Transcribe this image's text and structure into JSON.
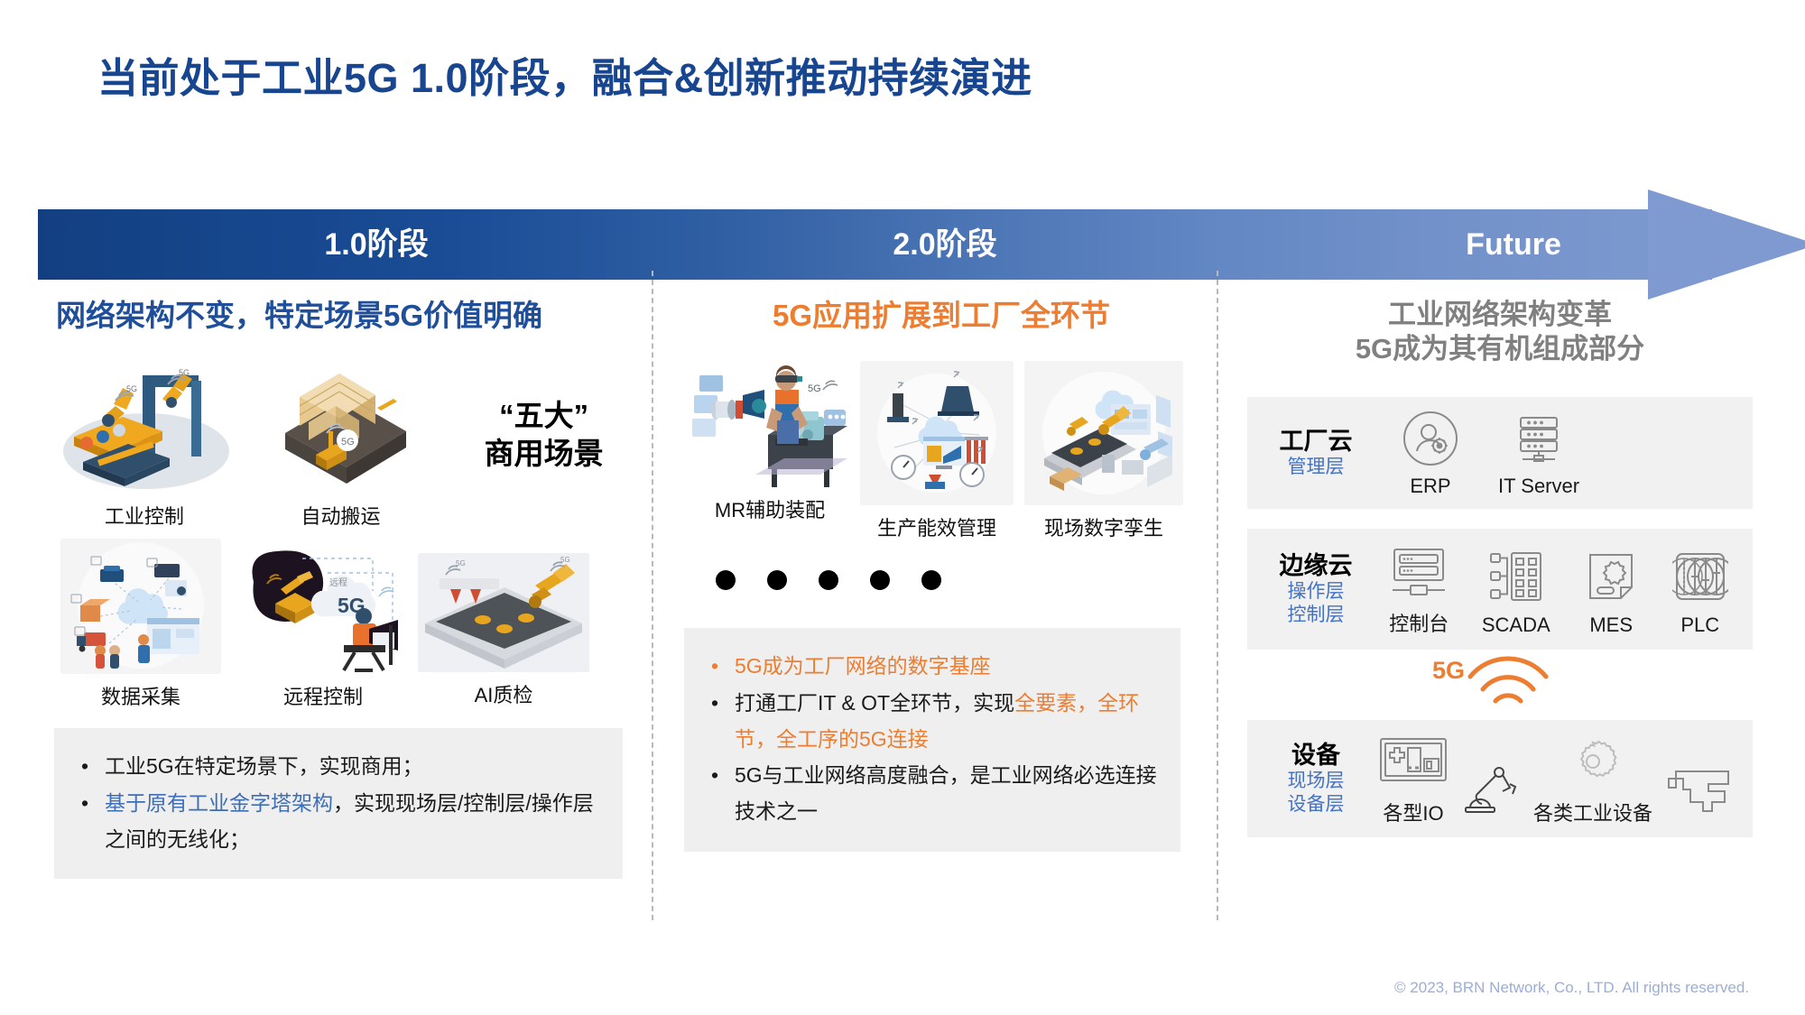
{
  "slide": {
    "title": "当前处于工业5G 1.0阶段，融合&创新推动持续演进",
    "footer": "© 2023, BRN Network, Co., LTD. All rights reserved."
  },
  "timeline": {
    "stages": [
      {
        "label": "1.0阶段"
      },
      {
        "label": "2.0阶段"
      },
      {
        "label": "Future"
      }
    ],
    "gradient_from": "#133f82",
    "gradient_to": "#7e9ad0"
  },
  "columns": [
    {
      "heading": "网络架构不变，特定场景5G价值明确",
      "heading_color": "#1F4E9B",
      "slogan_line1": "“五大”",
      "slogan_line2": "商用场景",
      "scenarios": [
        {
          "caption": "工业控制",
          "art": "robot-assembly-line"
        },
        {
          "caption": "自动搬运",
          "art": "warehouse-forklift"
        },
        {
          "caption": "数据采集",
          "art": "data-collection-cloud"
        },
        {
          "caption": "远程控制",
          "art": "remote-control-excavator"
        },
        {
          "caption": "AI质检",
          "art": "ai-inspection-conveyor"
        }
      ],
      "bullets": [
        {
          "runs": [
            {
              "text": "工业5G在特定场景下，实现商用；",
              "style": "normal"
            }
          ]
        },
        {
          "runs": [
            {
              "text": "基于原有工业金字塔架构",
              "style": "blue"
            },
            {
              "text": "，实现现场层/控制层/操作层之间的无线化；",
              "style": "normal"
            }
          ]
        }
      ]
    },
    {
      "heading": "5G应用扩展到工厂全环节",
      "heading_color": "#ED7D31",
      "scenarios": [
        {
          "caption": "MR辅助装配",
          "art": "mr-assisted-assembly"
        },
        {
          "caption": "生产能效管理",
          "art": "production-efficiency"
        },
        {
          "caption": "现场数字孪生",
          "art": "digital-twin"
        }
      ],
      "dot_count": 5,
      "bullets": [
        {
          "runs": [
            {
              "text": "5G成为工厂网络的数字基座",
              "style": "orange"
            }
          ]
        },
        {
          "runs": [
            {
              "text": "打通工厂IT & OT全环节，实现",
              "style": "normal"
            },
            {
              "text": "全要素，全环节，全工序的5G连接",
              "style": "orange"
            }
          ]
        },
        {
          "runs": [
            {
              "text": "5G与工业网络高度融合，是工业网络必选连接技术之一",
              "style": "normal"
            }
          ]
        }
      ]
    },
    {
      "heading_line1": "工业网络架构变革",
      "heading_line2": "5G成为其有机组成部分",
      "heading_color": "#808080",
      "architecture": {
        "layers": [
          {
            "name": "工厂云",
            "sublayers": [
              "管理层"
            ],
            "items": [
              {
                "label": "ERP",
                "icon": "erp-user-gear-icon"
              },
              {
                "label": "IT Server",
                "icon": "server-rack-icon"
              }
            ]
          },
          {
            "name": "边缘云",
            "sublayers": [
              "操作层",
              "控制层"
            ],
            "items": [
              {
                "label": "控制台",
                "icon": "control-console-icon"
              },
              {
                "label": "SCADA",
                "icon": "scada-grid-icon"
              },
              {
                "label": "MES",
                "icon": "mes-document-icon"
              },
              {
                "label": "PLC",
                "icon": "plc-slider-icon"
              }
            ]
          },
          {
            "name": "设备",
            "sublayers": [
              "现场层",
              "设备层"
            ],
            "items": [
              {
                "label": "各型IO",
                "icon": "io-module-icon"
              },
              {
                "label": "",
                "icon": "robot-arm-icon"
              },
              {
                "label": "各类工业设备",
                "icon": "gear-wheel-icon"
              },
              {
                "label": "",
                "icon": "industrial-camera-icon"
              }
            ]
          }
        ],
        "connector": {
          "label": "5G",
          "icon": "wifi-signal-icon",
          "color": "#ED7D31"
        }
      }
    }
  ]
}
